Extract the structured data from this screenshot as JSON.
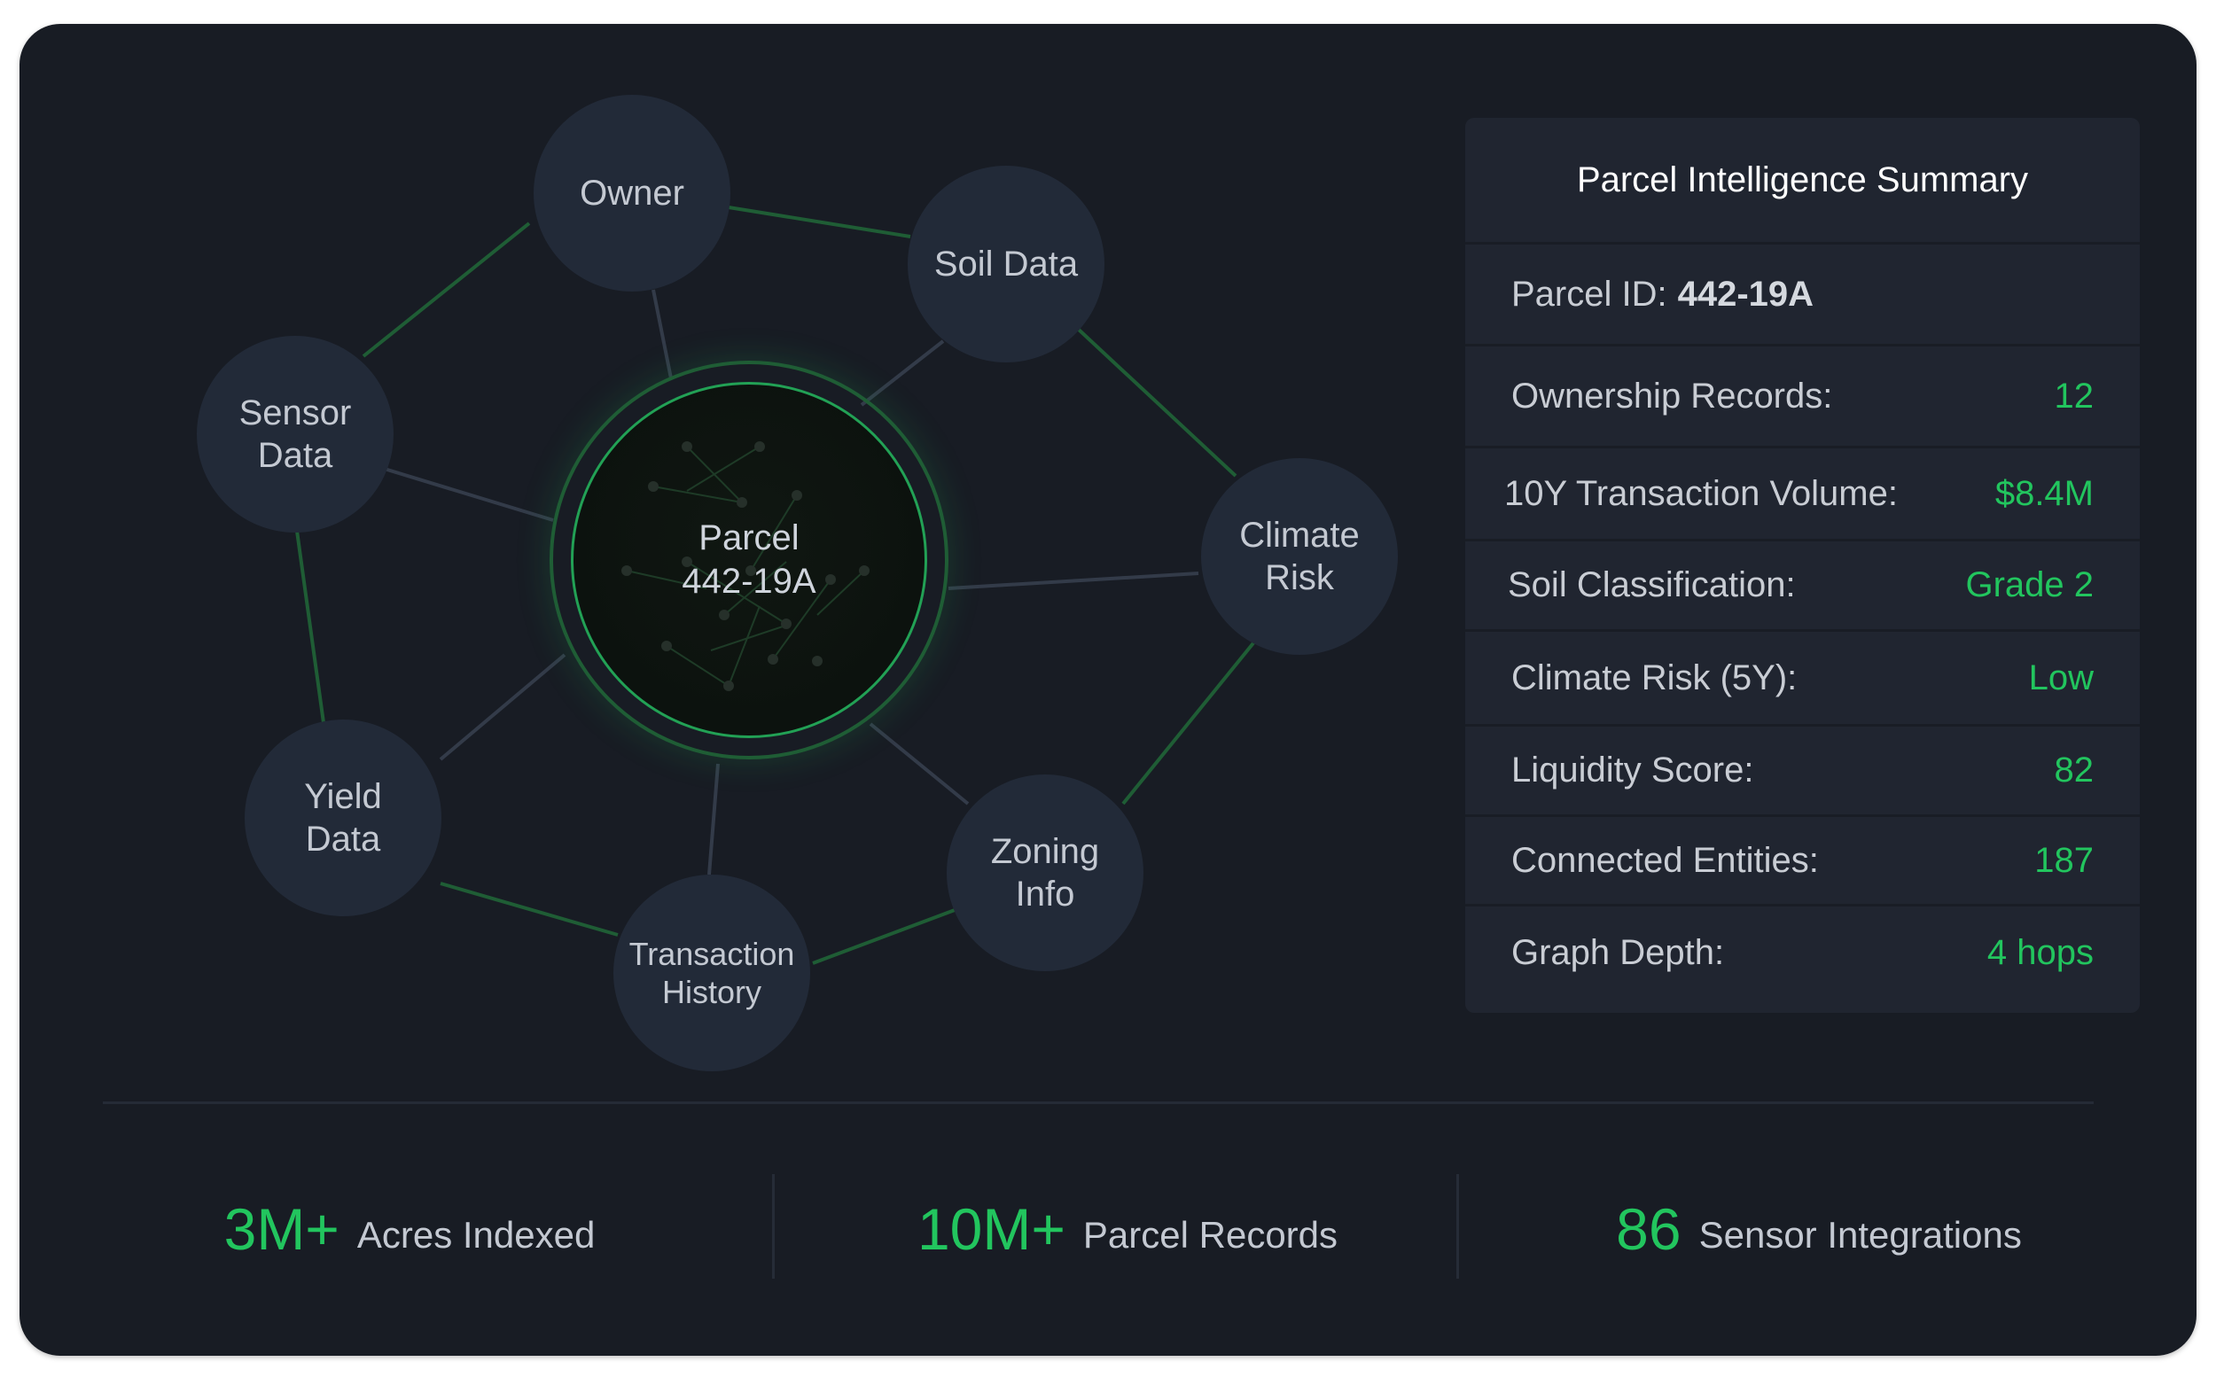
{
  "graph": {
    "hub": {
      "line1": "Parcel",
      "line2": "442-19A"
    },
    "nodes": {
      "owner": {
        "line1": "Owner"
      },
      "soil": {
        "line1": "Soil Data"
      },
      "sensor": {
        "line1": "Sensor",
        "line2": "Data"
      },
      "climate": {
        "line1": "Climate",
        "line2": "Risk"
      },
      "yield": {
        "line1": "Yield",
        "line2": "Data"
      },
      "zoning": {
        "line1": "Zoning",
        "line2": "Info"
      },
      "transaction": {
        "line1": "Transaction",
        "line2": "History"
      }
    }
  },
  "summary": {
    "title": "Parcel Intelligence Summary",
    "parcel_id_label": "Parcel ID:",
    "parcel_id_value": "442-19A",
    "rows": [
      {
        "label": "Ownership Records:",
        "value": "12"
      },
      {
        "label": "10Y Transaction Volume:",
        "value": "$8.4M"
      },
      {
        "label": "Soil Classification:",
        "value": "Grade 2"
      },
      {
        "label": "Climate Risk (5Y):",
        "value": "Low"
      },
      {
        "label": "Liquidity Score:",
        "value": "82"
      },
      {
        "label": "Connected Entities:",
        "value": "187"
      },
      {
        "label": "Graph Depth:",
        "value": "4 hops"
      }
    ]
  },
  "stats": [
    {
      "number": "3M+",
      "label": "Acres Indexed"
    },
    {
      "number": "10M+",
      "label": "Parcel Records"
    },
    {
      "number": "86",
      "label": "Sensor Integrations"
    }
  ],
  "colors": {
    "background": "#181c24",
    "node": "#222a38",
    "accent": "#22c55e",
    "green_edge": "#1f5d35",
    "gray_edge": "#333b49"
  }
}
